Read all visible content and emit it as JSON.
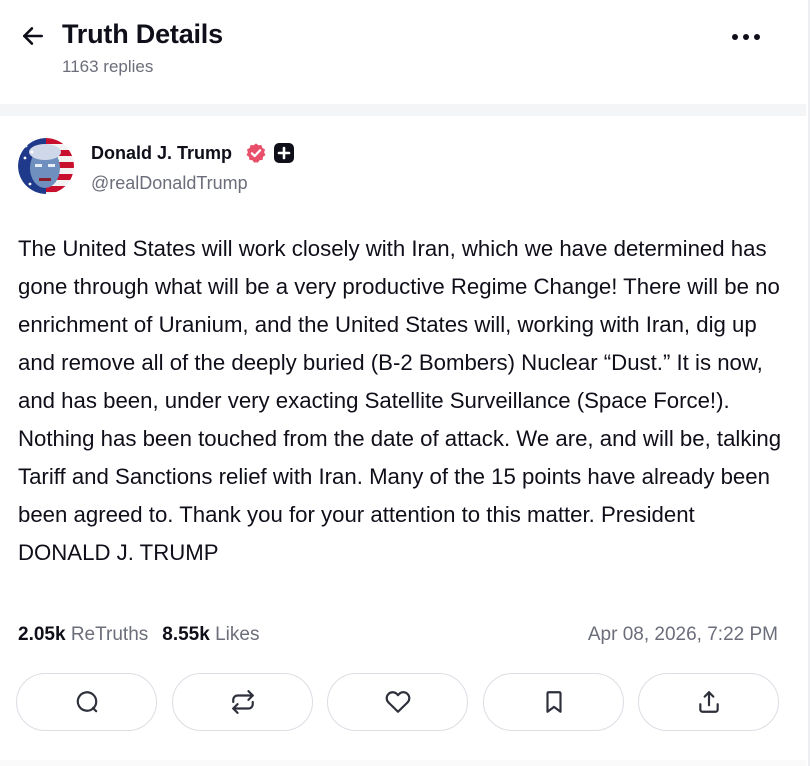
{
  "header": {
    "title": "Truth Details",
    "replies": "1163 replies",
    "back_icon": "arrow-left-icon",
    "more_icon": "more-horizontal-icon"
  },
  "post": {
    "author": {
      "name": "Donald J. Trump",
      "handle": "@realDonaldTrump",
      "verified_icon": "verified-badge-icon",
      "verified_color": "#e94f6b",
      "plus_icon": "plus-badge-icon"
    },
    "body": "The United States will work closely with Iran, which we have determined has gone through what will be a very productive Regime Change! There will be no enrichment of Uranium, and the United States will, working with Iran, dig up and remove all of the deeply buried (B-2 Bombers) Nuclear “Dust.” It is now, and has been, under very exacting Satellite Surveillance (Space Force!). Nothing has been touched from the date of attack. We are, and will be, talking Tariff and Sanctions relief with Iran. Many of the 15 points have already been been agreed to. Thank you for your attention to this matter. President DONALD J. TRUMP",
    "stats": {
      "retruths_count": "2.05k",
      "retruths_label": "ReTruths",
      "likes_count": "8.55k",
      "likes_label": "Likes"
    },
    "timestamp": "Apr 08, 2026, 7:22 PM"
  },
  "actions": [
    {
      "name": "reply",
      "icon": "comment-icon"
    },
    {
      "name": "retruth",
      "icon": "repost-icon"
    },
    {
      "name": "like",
      "icon": "heart-icon"
    },
    {
      "name": "bookmark",
      "icon": "bookmark-icon"
    },
    {
      "name": "share",
      "icon": "share-icon"
    }
  ],
  "colors": {
    "text": "#0f0f1a",
    "muted": "#6b6e7a",
    "border": "#dcdee4"
  }
}
